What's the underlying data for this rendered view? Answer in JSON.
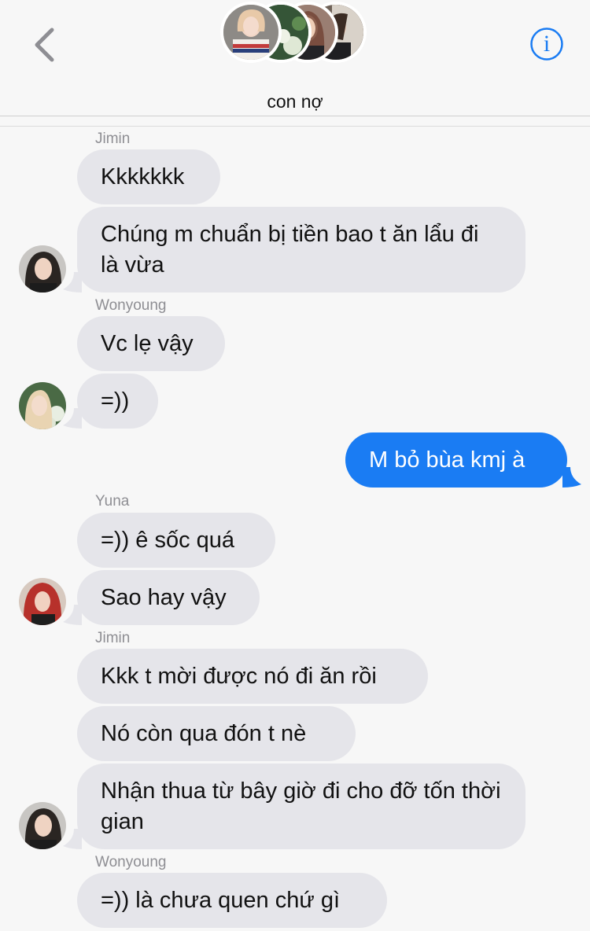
{
  "header": {
    "title": "con nợ",
    "back_icon": "chevron-left-icon",
    "info_icon": "info-icon",
    "info_glyph": "i",
    "accent": "#1a7cf3"
  },
  "messages": [
    {
      "sender": "Jimin"
    },
    {
      "text": "Kkkkkkk"
    },
    {
      "text": "Chúng m chuẩn bị tiền bao t ăn lẩu đi là vừa"
    },
    {
      "sender": "Wonyoung"
    },
    {
      "text": "Vc lẹ vậy"
    },
    {
      "text": "=))"
    },
    {
      "text": "M bỏ bùa kmj à"
    },
    {
      "sender": "Yuna"
    },
    {
      "text": "=)) ê sốc quá"
    },
    {
      "text": "Sao hay vậy"
    },
    {
      "sender": "Jimin"
    },
    {
      "text": "Kkk t mời được nó đi ăn rồi"
    },
    {
      "text": "Nó còn qua đón t nè"
    },
    {
      "text": "Nhận thua từ bây giờ đi cho đỡ tốn thời gian"
    },
    {
      "sender": "Wonyoung"
    },
    {
      "text": "=)) là chưa quen chứ gì"
    }
  ],
  "colors": {
    "incoming_bubble": "#e5e5ea",
    "outgoing_bubble": "#1a7cf3",
    "background": "#f7f7f7"
  }
}
